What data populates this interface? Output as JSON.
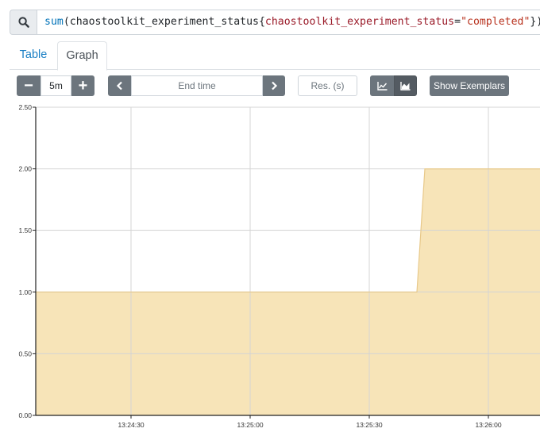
{
  "query": {
    "icon": "search-icon",
    "fn": "sum",
    "open_paren": "(",
    "metric": "chaostoolkit_experiment_status",
    "open_brace": "{",
    "label_name": "chaostoolkit_experiment_status",
    "equals": "=",
    "label_value": "\"completed\"",
    "close": "})"
  },
  "tabs": {
    "table": "Table",
    "graph": "Graph",
    "active": "Graph"
  },
  "controls": {
    "range_minus": "−",
    "range_value": "5m",
    "range_plus": "+",
    "prev_icon": "chevron-left-icon",
    "end_time_placeholder": "End time",
    "next_icon": "chevron-right-icon",
    "resolution_placeholder": "Res. (s)",
    "chart_line_icon": "line-chart-icon",
    "chart_stacked_icon": "stacked-area-chart-icon",
    "stacked_active": true,
    "exemplars_label": "Show Exemplars"
  },
  "colors": {
    "area_fill": "#f7e4b8",
    "area_stroke": "#e8c98a",
    "button_dark": "#6c757d",
    "link_blue": "#1a7fc4"
  },
  "chart_data": {
    "type": "area",
    "title": "",
    "xlabel": "",
    "ylabel": "",
    "ylim": [
      0,
      2.5
    ],
    "y_ticks": [
      "0.00",
      "0.50",
      "1.00",
      "1.50",
      "2.00",
      "2.50"
    ],
    "x_ticks": [
      "13:24:30",
      "13:25:00",
      "13:25:30",
      "13:26:00"
    ],
    "grid": true,
    "series": [
      {
        "x": [
          "13:24:06",
          "13:25:42",
          "13:25:44",
          "13:26:13"
        ],
        "values": [
          1,
          1,
          2,
          2
        ]
      }
    ]
  }
}
